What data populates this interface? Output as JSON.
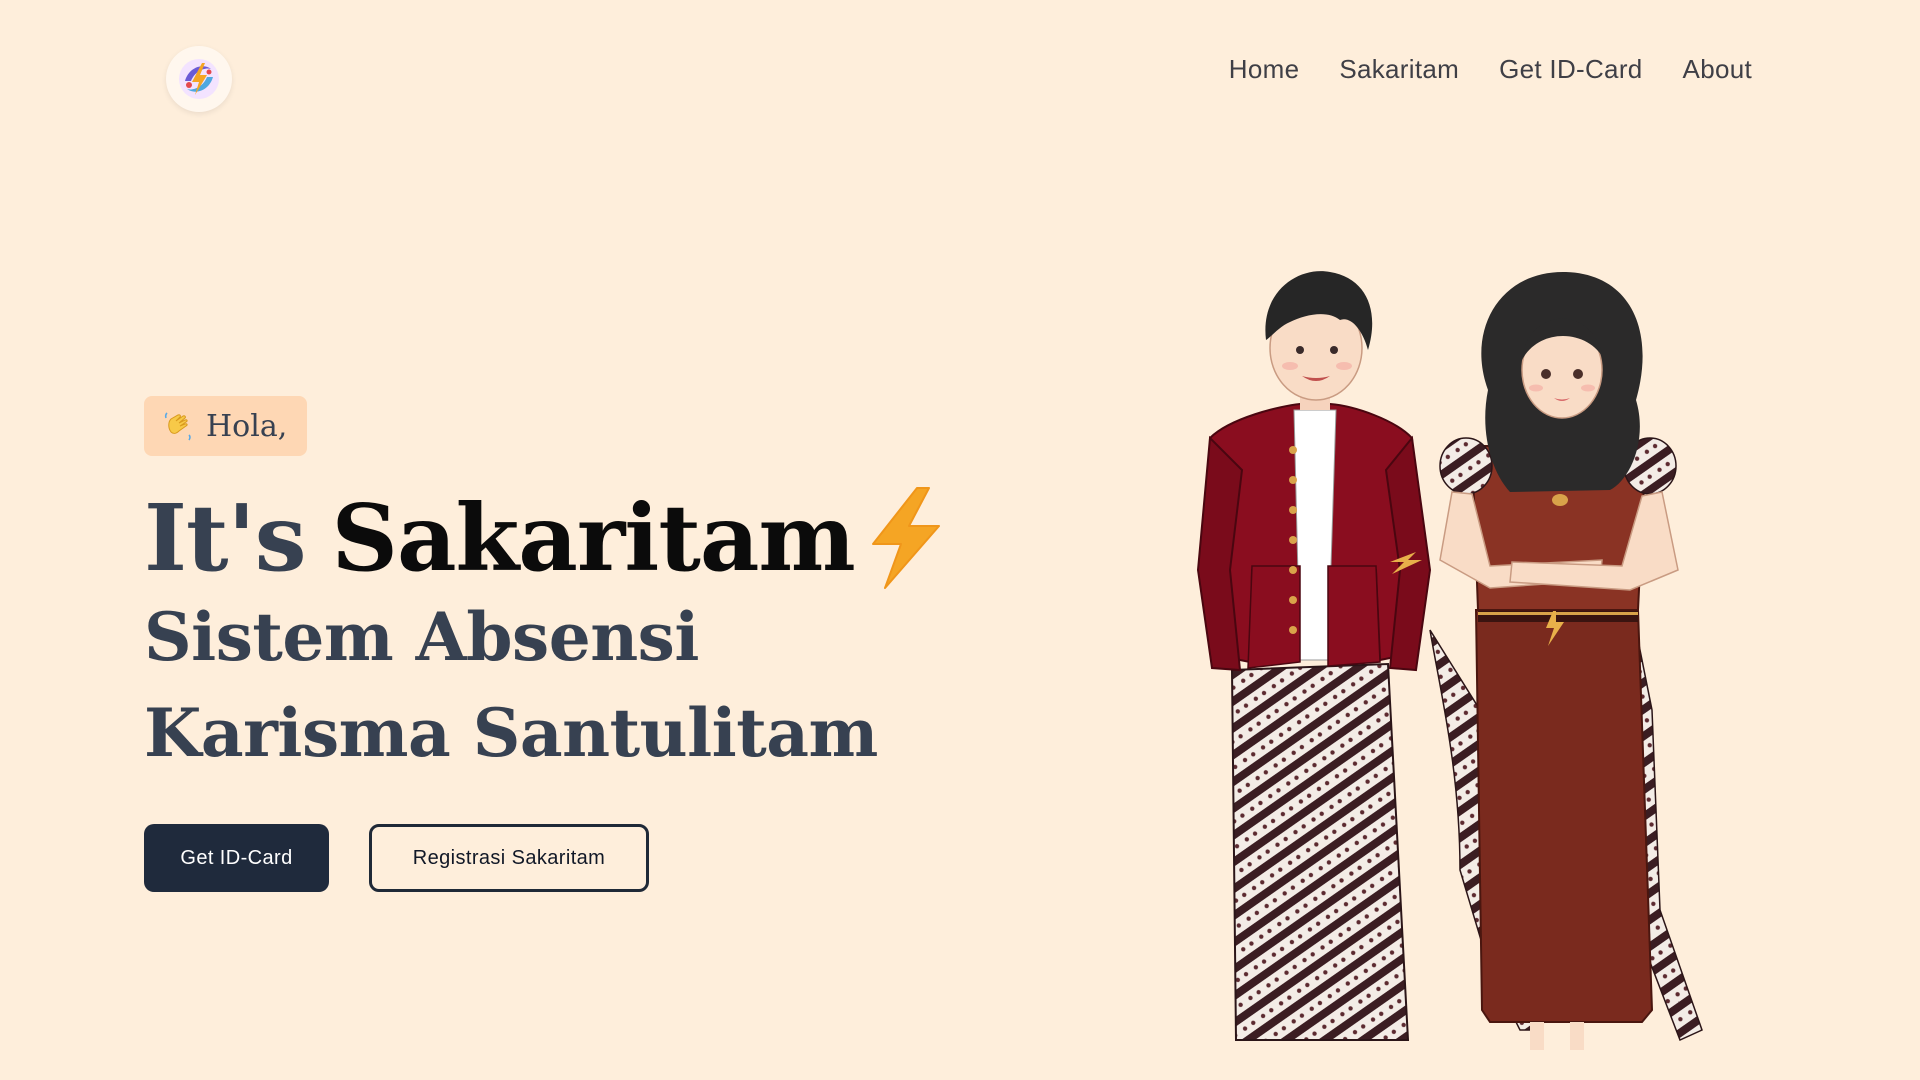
{
  "nav": {
    "logo_icon": "sakaritam-logo-icon",
    "links": [
      "Home",
      "Sakaritam",
      "Get ID-Card",
      "About"
    ]
  },
  "hero": {
    "greeting_icon": "waving-hand-icon",
    "greeting": "Hola,",
    "headline_prefix": "It's",
    "headline_name": "Sakaritam",
    "headline_icon": "lightning-bolt-icon",
    "subtitle_line1": "Sistem Absensi",
    "subtitle_line2": "Karisma Santulitam",
    "primary_button": "Get ID-Card",
    "secondary_button": "Registrasi Sakaritam"
  },
  "illustration": {
    "description_icon": "couple-batik-illustration"
  },
  "colors": {
    "background": "#feeedb",
    "greeting_bg": "#fed7b4",
    "primary_button_bg": "#1f2a3c",
    "bolt": "#f5a524",
    "text": "#374151"
  }
}
